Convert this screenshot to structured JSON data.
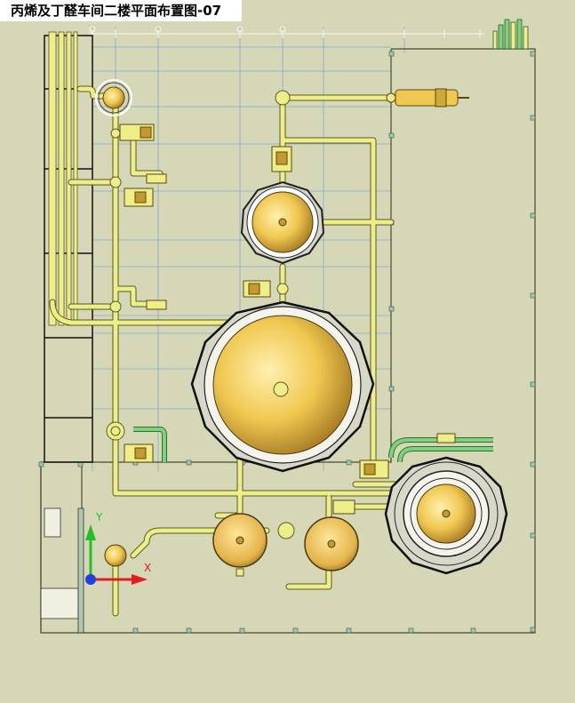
{
  "title": "丙烯及丁醛车间二楼平面布置图-07",
  "axis_labels": {
    "y": "Y",
    "x": "X"
  },
  "colors": {
    "background": "#d6d7b6",
    "pipe": "#eeee88",
    "pipe_outline": "#5a5a28",
    "vessel_fill": "#f0c850",
    "grid": "#6fa6d8",
    "green_pipe": "#5fc05f",
    "axis_x": "#e02020",
    "axis_y": "#20c020",
    "axis_origin": "#2040e0"
  }
}
